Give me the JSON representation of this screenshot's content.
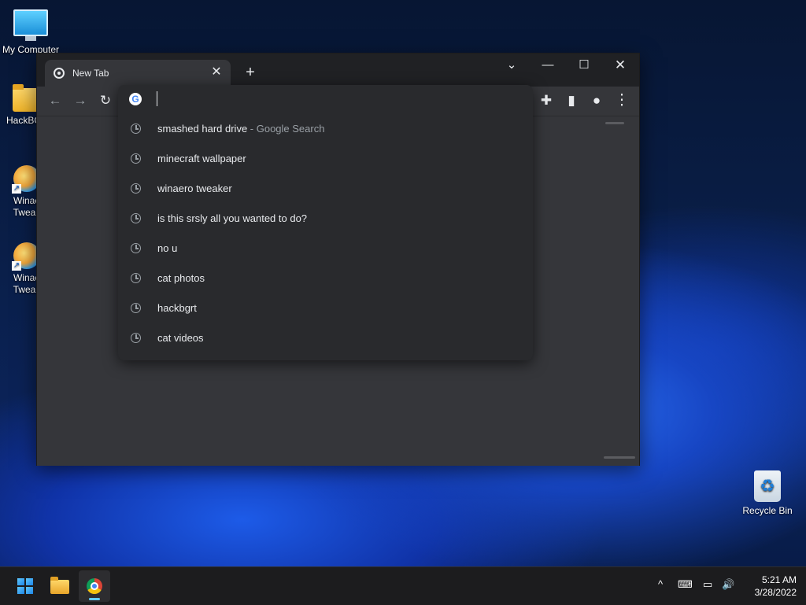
{
  "desktop": {
    "icons": [
      {
        "label": "My Computer",
        "icon": "monitor-icon"
      },
      {
        "label": "HackBGF",
        "icon": "folder-icon"
      },
      {
        "label": "Winae",
        "label2": "Tweak",
        "icon": "winaero-icon"
      },
      {
        "label": "Winae",
        "label2": "Tweak",
        "icon": "winaero-icon"
      },
      {
        "label": "Recycle Bin",
        "icon": "recycle-bin-icon"
      }
    ]
  },
  "browser": {
    "tab": {
      "title": "New Tab",
      "close": "✕"
    },
    "new_tab": "+",
    "window_controls": {
      "dropdown": "⌄",
      "minimize": "—",
      "maximize": "☐",
      "close": "✕"
    },
    "toolbar": {
      "back": "←",
      "forward": "→",
      "reload": "↻",
      "extensions": "✚",
      "side_panel": "▮",
      "profile": "●",
      "menu": "⋮"
    },
    "omnibox": {
      "value": "",
      "suggestions": [
        {
          "text": "smashed hard drive",
          "sub": " - Google Search"
        },
        {
          "text": "minecraft wallpaper",
          "sub": ""
        },
        {
          "text": "winaero tweaker",
          "sub": ""
        },
        {
          "text": "is this srsly all you wanted to do?",
          "sub": ""
        },
        {
          "text": "no u",
          "sub": ""
        },
        {
          "text": "cat photos",
          "sub": ""
        },
        {
          "text": "hackbgrt",
          "sub": ""
        },
        {
          "text": "cat videos",
          "sub": ""
        }
      ]
    }
  },
  "taskbar": {
    "apps": [
      {
        "name": "start",
        "icon": "windows-start-icon"
      },
      {
        "name": "file-explorer",
        "icon": "folder-icon"
      },
      {
        "name": "chrome",
        "icon": "chrome-icon",
        "active": true
      }
    ],
    "tray": {
      "chevron": "^",
      "keyboard": "⌨",
      "network": "▭",
      "volume": "🔊"
    },
    "time": "5:21 AM",
    "date": "3/28/2022"
  },
  "colors": {
    "accent": "#60cdff",
    "chrome_dark": "#35363a",
    "omnibox_bg": "#292a2d"
  }
}
